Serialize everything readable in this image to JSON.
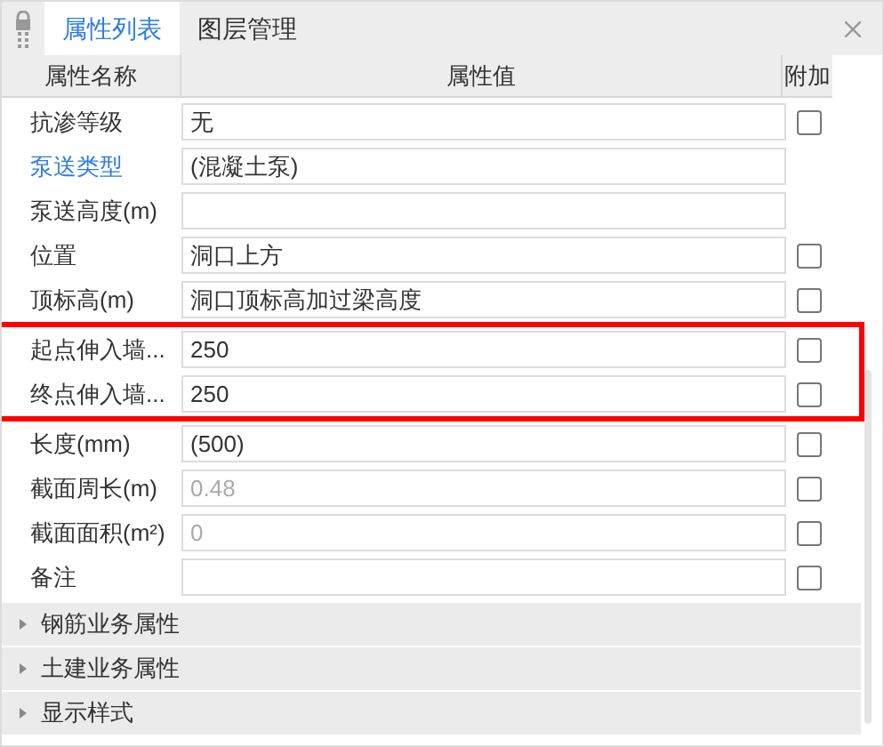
{
  "tabs": [
    {
      "label": "属性列表",
      "selected": true
    },
    {
      "label": "图层管理",
      "selected": false
    }
  ],
  "columns": [
    "属性名称",
    "属性值",
    "附加"
  ],
  "rows": [
    {
      "name": "抗渗等级",
      "value": "无",
      "link": false,
      "disabled": false,
      "highlighted": false,
      "checkbox": {
        "checked": false
      }
    },
    {
      "name": "泵送类型",
      "value": "(混凝土泵)",
      "link": true,
      "disabled": false,
      "highlighted": false
    },
    {
      "name": "泵送高度(m)",
      "link": false,
      "highlighted": false
    },
    {
      "name": "位置",
      "value": "洞口上方",
      "link": false,
      "disabled": false,
      "highlighted": false,
      "checkbox": {
        "checked": false
      }
    },
    {
      "name": "顶标高(m)",
      "value": "洞口顶标高加过梁高度",
      "link": false,
      "disabled": false,
      "highlighted": false,
      "checkbox": {
        "checked": false
      }
    },
    {
      "name": "起点伸入墙...",
      "value": "250",
      "link": false,
      "disabled": false,
      "highlighted": true,
      "checkbox": {
        "checked": false
      }
    },
    {
      "name": "终点伸入墙...",
      "value": "250",
      "link": false,
      "disabled": false,
      "highlighted": true,
      "checkbox": {
        "checked": false
      }
    },
    {
      "name": "长度(mm)",
      "value": "(500)",
      "link": false,
      "disabled": false,
      "highlighted": false,
      "checkbox": {
        "checked": false
      }
    },
    {
      "name": "截面周长(m)",
      "value": "0.48",
      "link": false,
      "disabled": true,
      "highlighted": false,
      "checkbox": {
        "checked": false
      }
    },
    {
      "name": "截面面积(m²)",
      "value": "0",
      "link": false,
      "disabled": true,
      "highlighted": false,
      "checkbox": {
        "checked": false
      }
    },
    {
      "name": "备注",
      "link": false,
      "highlighted": false,
      "checkbox": {
        "checked": false
      }
    }
  ],
  "groups": [
    {
      "label": "钢筋业务属性",
      "expanded": false
    },
    {
      "label": "土建业务属性",
      "expanded": false
    },
    {
      "label": "显示样式",
      "expanded": false
    }
  ]
}
